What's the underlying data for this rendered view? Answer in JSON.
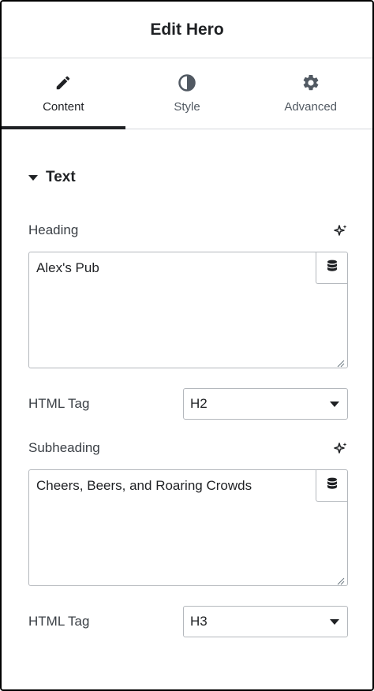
{
  "header": {
    "title": "Edit Hero"
  },
  "tabs": [
    {
      "label": "Content",
      "icon": "pencil-icon",
      "active": true
    },
    {
      "label": "Style",
      "icon": "contrast-icon",
      "active": false
    },
    {
      "label": "Advanced",
      "icon": "gear-icon",
      "active": false
    }
  ],
  "section": {
    "title": "Text"
  },
  "heading": {
    "label": "Heading",
    "value": "Alex's Pub"
  },
  "heading_tag": {
    "label": "HTML Tag",
    "value": "H2"
  },
  "subheading": {
    "label": "Subheading",
    "value": "Cheers, Beers, and Roaring Crowds"
  },
  "subheading_tag": {
    "label": "HTML Tag",
    "value": "H3"
  }
}
